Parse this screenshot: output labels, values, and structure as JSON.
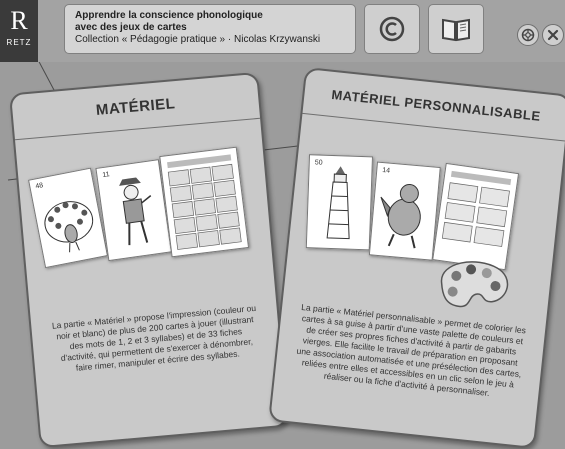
{
  "header": {
    "title_line1": "Apprendre la conscience phonologique",
    "title_line2": "avec des jeux de cartes",
    "collection": "Collection « Pédagogie pratique » · Nicolas Krzywanski",
    "logo_letter": "R",
    "logo_text": "RETZ"
  },
  "cards": {
    "materiel": {
      "title": "MATÉRIEL",
      "card1_number": "48",
      "card2_number": "11",
      "description": "La partie « Matériel » propose l'impression (couleur ou noir et blanc) de plus de 200 cartes à jouer (illustrant des mots de 1, 2 et 3 syllabes) et de 33 fiches d'activité, qui permettent de s'exercer à dénombrer, faire rimer, manipuler et écrire des syllabes."
    },
    "personnalisable": {
      "title": "MATÉRIEL PERSONNALISABLE",
      "card1_number": "50",
      "card2_number": "14",
      "description": "La partie « Matériel personnalisable » permet de colorier les cartes à sa guise à partir d'une vaste palette de couleurs et de créer ses propres fiches d'activité à partir de gabarits vierges. Elle facilite le travail de préparation en proposant une association automatisée et une présélection des cartes, reliées entre elles et accessibles en un clic selon le jeu à réaliser ou la fiche d'activité à personnaliser."
    }
  },
  "icons": {
    "copyright": "copyright-icon",
    "book": "book-icon",
    "help": "help-icon",
    "close": "close-icon"
  },
  "colors": {
    "background": "#9c9c9c",
    "card": "#c9c9c9",
    "logo": "#3a3a3a"
  }
}
